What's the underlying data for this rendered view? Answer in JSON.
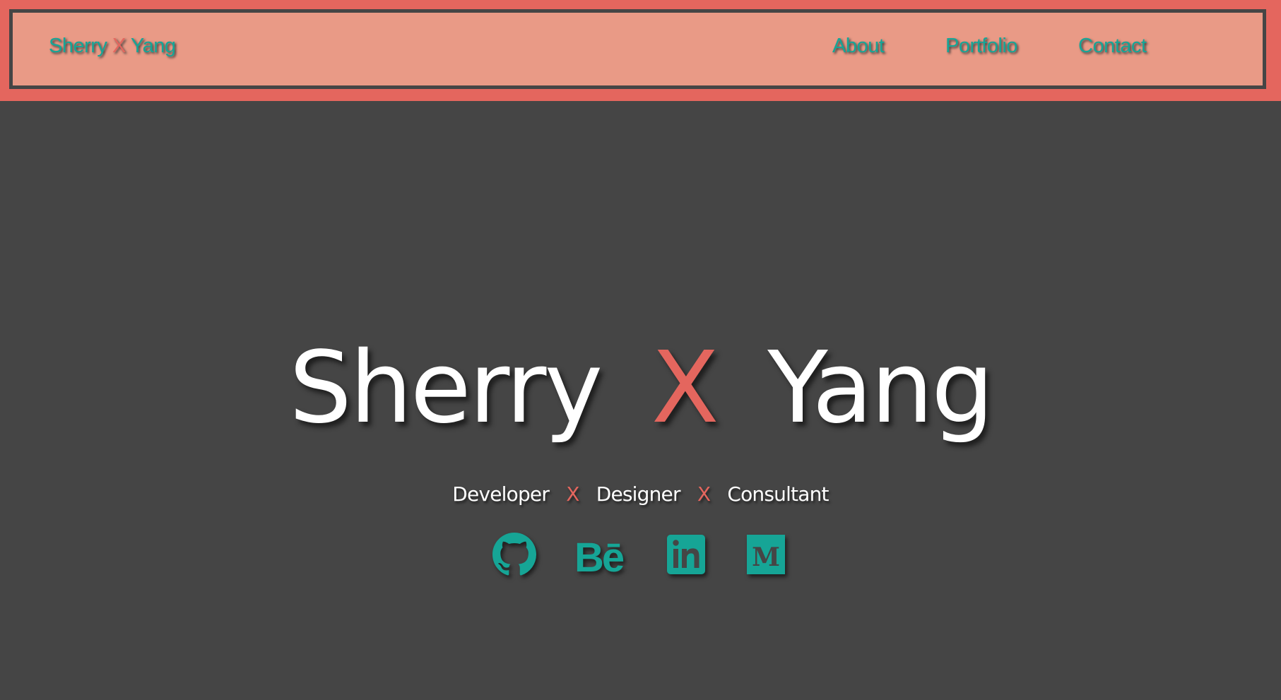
{
  "brand": {
    "first": "Sherry",
    "x": "X",
    "last": "Yang"
  },
  "nav": {
    "about": "About",
    "portfolio": "Portfolio",
    "contact": "Contact"
  },
  "hero": {
    "first": "Sherry",
    "x": "X",
    "last": "Yang"
  },
  "roles": {
    "role1": "Developer",
    "sep1": "X",
    "role2": "Designer",
    "sep2": "X",
    "role3": "Consultant"
  },
  "social": {
    "behance_text": "Bē",
    "medium_text": "M",
    "icons": [
      "github-icon",
      "behance-icon",
      "linkedin-icon",
      "medium-icon"
    ]
  },
  "colors": {
    "header_bg": "#e4665e",
    "header_inner_bg": "#e99a86",
    "page_bg": "#454545",
    "accent_teal": "#16a596",
    "accent_red": "#e4665e",
    "text_white": "#ffffff"
  }
}
